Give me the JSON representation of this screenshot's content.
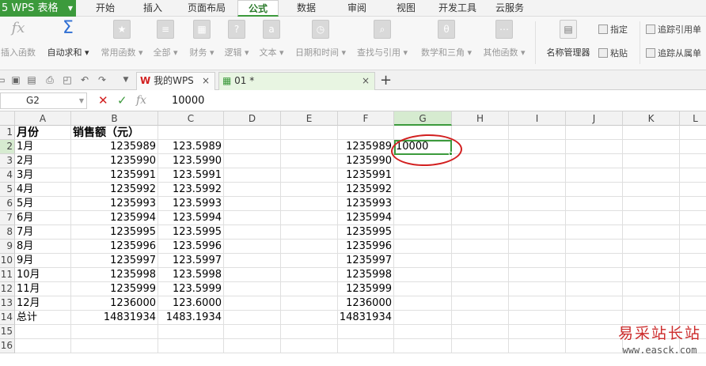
{
  "app": {
    "title": "5 WPS 表格"
  },
  "menu_tabs": [
    "开始",
    "插入",
    "页面布局",
    "公式",
    "数据",
    "审阅",
    "视图",
    "开发工具",
    "云服务"
  ],
  "active_menu_tab": "公式",
  "ribbon": {
    "insert_function": "插入函数",
    "autosum": "自动求和",
    "common_functions": "常用函数",
    "all": "全部",
    "financial": "财务",
    "logical": "逻辑",
    "text": "文本",
    "datetime": "日期和时间",
    "lookup": "查找与引用",
    "math_trig": "数学和三角",
    "other_functions": "其他函数",
    "name_manager": "名称管理器",
    "specify": "指定",
    "paste": "粘贴",
    "trace_precedents": "追踪引用单",
    "trace_dependents": "追踪从属单"
  },
  "doc_tabs": [
    {
      "label": "我的WPS",
      "close": "×"
    },
    {
      "label": "01 *",
      "close": "×"
    }
  ],
  "add_tab": "+",
  "formula_bar": {
    "name_box": "G2",
    "cancel": "✕",
    "confirm": "✓",
    "fx": "fx",
    "value": "10000"
  },
  "columns": [
    "A",
    "B",
    "C",
    "D",
    "E",
    "F",
    "G",
    "H",
    "I",
    "J",
    "K",
    "L"
  ],
  "rows": [
    {
      "n": "1",
      "A": "月份",
      "B": "销售额（元）",
      "C": "",
      "F": "",
      "G": ""
    },
    {
      "n": "2",
      "A": "1月",
      "B": "1235989",
      "C": "123.5989",
      "F": "1235989",
      "G": "10000"
    },
    {
      "n": "3",
      "A": "2月",
      "B": "1235990",
      "C": "123.5990",
      "F": "1235990",
      "G": ""
    },
    {
      "n": "4",
      "A": "3月",
      "B": "1235991",
      "C": "123.5991",
      "F": "1235991",
      "G": ""
    },
    {
      "n": "5",
      "A": "4月",
      "B": "1235992",
      "C": "123.5992",
      "F": "1235992",
      "G": ""
    },
    {
      "n": "6",
      "A": "5月",
      "B": "1235993",
      "C": "123.5993",
      "F": "1235993",
      "G": ""
    },
    {
      "n": "7",
      "A": "6月",
      "B": "1235994",
      "C": "123.5994",
      "F": "1235994",
      "G": ""
    },
    {
      "n": "8",
      "A": "7月",
      "B": "1235995",
      "C": "123.5995",
      "F": "1235995",
      "G": ""
    },
    {
      "n": "9",
      "A": "8月",
      "B": "1235996",
      "C": "123.5996",
      "F": "1235996",
      "G": ""
    },
    {
      "n": "10",
      "A": "9月",
      "B": "1235997",
      "C": "123.5997",
      "F": "1235997",
      "G": ""
    },
    {
      "n": "11",
      "A": "10月",
      "B": "1235998",
      "C": "123.5998",
      "F": "1235998",
      "G": ""
    },
    {
      "n": "12",
      "A": "11月",
      "B": "1235999",
      "C": "123.5999",
      "F": "1235999",
      "G": ""
    },
    {
      "n": "13",
      "A": "12月",
      "B": "1236000",
      "C": "123.6000",
      "F": "1236000",
      "G": ""
    },
    {
      "n": "14",
      "A": "总计",
      "B": "14831934",
      "C": "1483.1934",
      "F": "14831934",
      "G": ""
    },
    {
      "n": "15",
      "A": "",
      "B": "",
      "C": "",
      "F": "",
      "G": ""
    },
    {
      "n": "16",
      "A": "",
      "B": "",
      "C": "",
      "F": "",
      "G": ""
    }
  ],
  "active_cell": "G2",
  "watermark": {
    "line1": "易采站长站",
    "line2": "www.easck.com"
  },
  "colors": {
    "accent": "#3c9a3c",
    "annotation": "#d21f1f"
  }
}
